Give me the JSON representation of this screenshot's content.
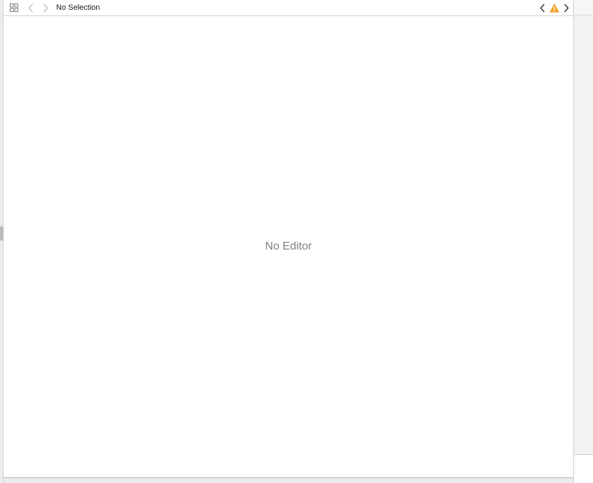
{
  "jumpbar": {
    "title": "No Selection",
    "icons": {
      "grid": "related-items-grid-icon",
      "back": "chevron-left-icon",
      "forward": "chevron-right-icon",
      "issue_prev": "chevron-left-icon",
      "warning": "warning-triangle-icon",
      "issue_next": "chevron-right-icon"
    },
    "warning_color": "#F5A623"
  },
  "editor": {
    "placeholder": "No Editor"
  }
}
